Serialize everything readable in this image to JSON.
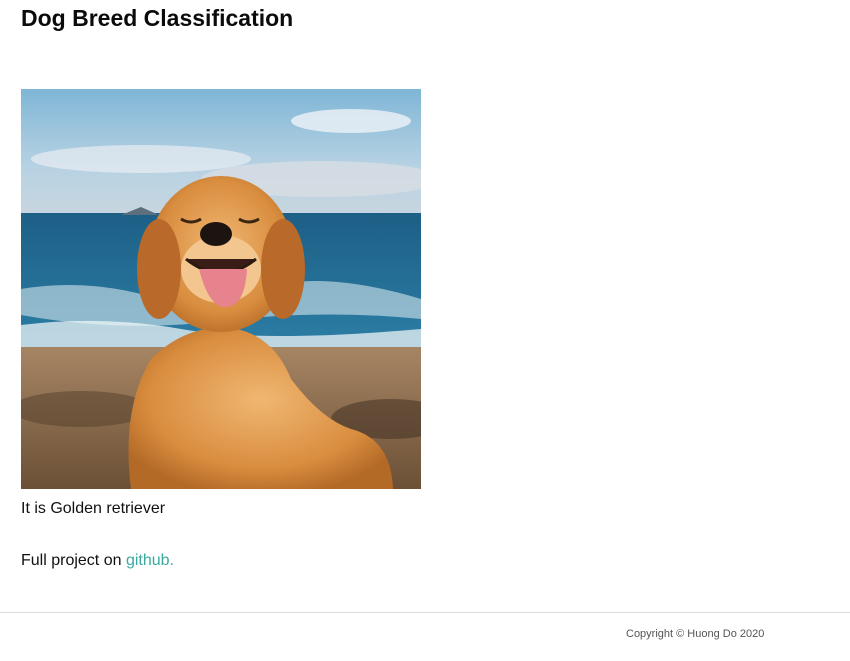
{
  "page": {
    "title": "Dog Breed Classification"
  },
  "image": {
    "subject": "golden-retriever-photo"
  },
  "result": {
    "text": "It is Golden retriever"
  },
  "project": {
    "prefix": "Full project on ",
    "link_label": "github",
    "suffix": "."
  },
  "footer": {
    "copyright": "Copyright © Huong Do 2020"
  },
  "colors": {
    "link": "#3aa9a1",
    "rule": "#dcdcdc"
  }
}
